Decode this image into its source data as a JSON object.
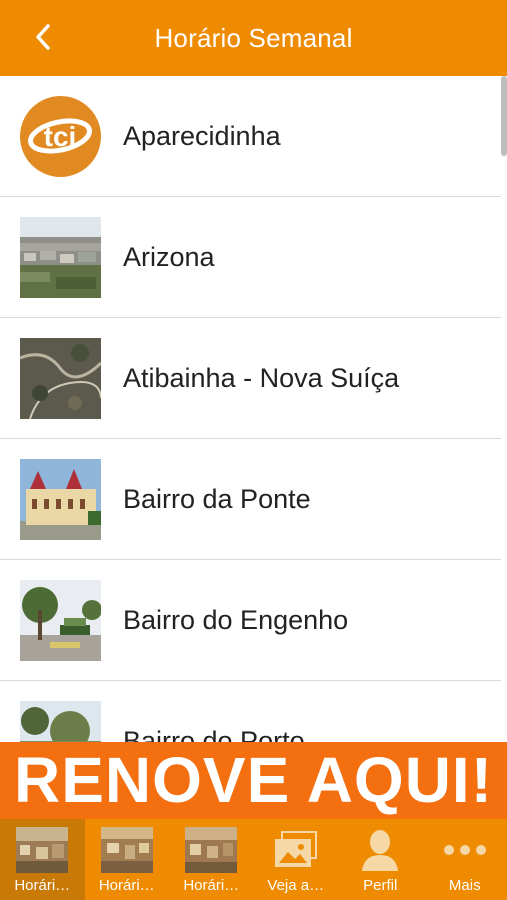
{
  "header": {
    "title": "Horário Semanal",
    "back_icon": "chevron-left-icon"
  },
  "list": {
    "items": [
      {
        "label": "Aparecidinha",
        "thumb": "tci-logo"
      },
      {
        "label": "Arizona",
        "thumb": "city-photo"
      },
      {
        "label": "Atibainha - Nova Suíça",
        "thumb": "aerial-photo"
      },
      {
        "label": "Bairro da Ponte",
        "thumb": "building-photo"
      },
      {
        "label": "Bairro do Engenho",
        "thumb": "plaza-photo"
      },
      {
        "label": "Bairro do Porto",
        "thumb": "trees-photo"
      }
    ]
  },
  "logo_text": "tci",
  "banner": {
    "text": "RENOVE AQUI!"
  },
  "tabs": [
    {
      "label": "Horári…",
      "icon": "city-thumbnail-icon",
      "active": true
    },
    {
      "label": "Horári…",
      "icon": "city-thumbnail-icon"
    },
    {
      "label": "Horári…",
      "icon": "city-thumbnail-icon"
    },
    {
      "label": "Veja a…",
      "icon": "gallery-icon"
    },
    {
      "label": "Perfil",
      "icon": "person-icon"
    },
    {
      "label": "Mais",
      "icon": "more-dots-icon"
    }
  ],
  "colors": {
    "accent": "#ee8b00",
    "banner": "#f36f10",
    "active_tab": "#c97a06"
  }
}
